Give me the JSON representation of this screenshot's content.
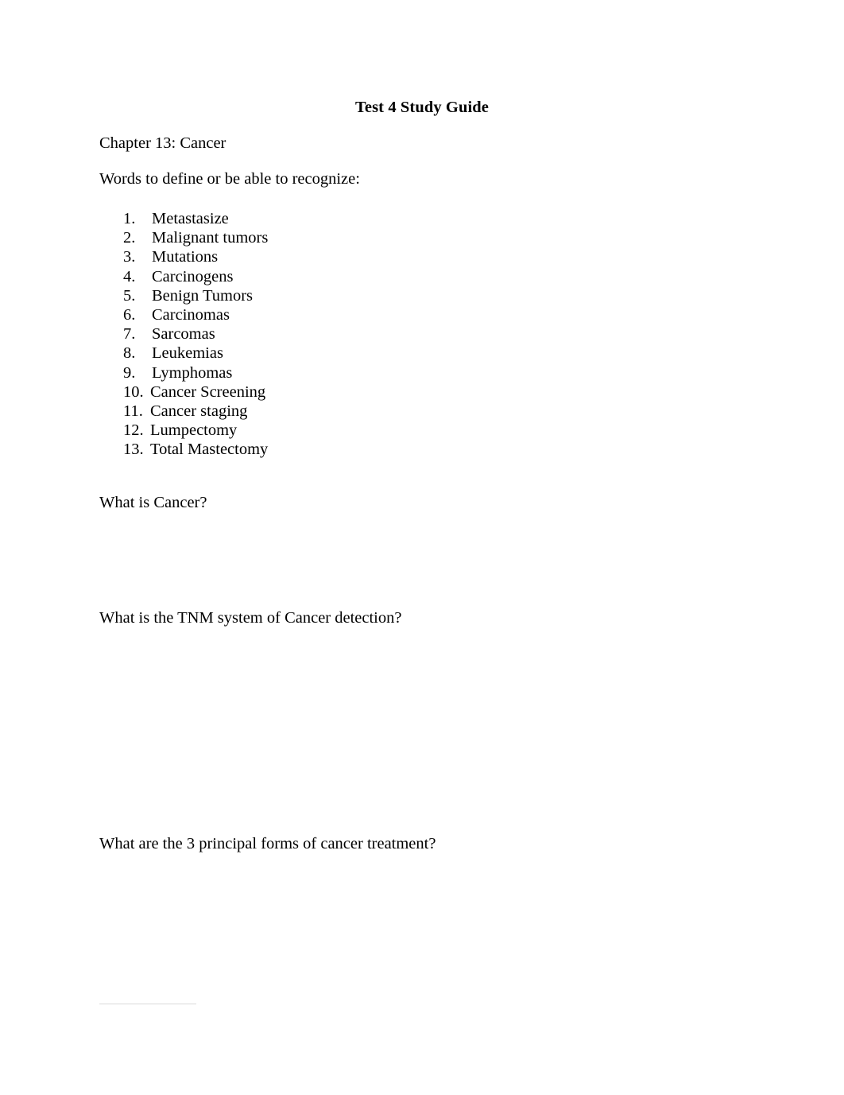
{
  "document": {
    "title": "Test 4 Study Guide",
    "chapter_heading": "Chapter 13: Cancer",
    "instruction": "Words to define or be able to recognize:",
    "terms": [
      {
        "number": "1.",
        "label": "Metastasize"
      },
      {
        "number": "2.",
        "label": "Malignant tumors"
      },
      {
        "number": "3.",
        "label": "Mutations"
      },
      {
        "number": "4.",
        "label": "Carcinogens"
      },
      {
        "number": "5.",
        "label": "Benign Tumors"
      },
      {
        "number": "6.",
        "label": "Carcinomas"
      },
      {
        "number": "7.",
        "label": "Sarcomas"
      },
      {
        "number": "8.",
        "label": "Leukemias"
      },
      {
        "number": "9.",
        "label": "Lymphomas"
      },
      {
        "number": "10.",
        "label": "Cancer Screening"
      },
      {
        "number": "11.",
        "label": "Cancer staging"
      },
      {
        "number": "12.",
        "label": "Lumpectomy"
      },
      {
        "number": "13.",
        "label": "Total Mastectomy"
      }
    ],
    "questions": [
      "What is Cancer?",
      "What is the TNM system of Cancer detection?",
      "What are the 3 principal forms of cancer treatment?"
    ]
  }
}
